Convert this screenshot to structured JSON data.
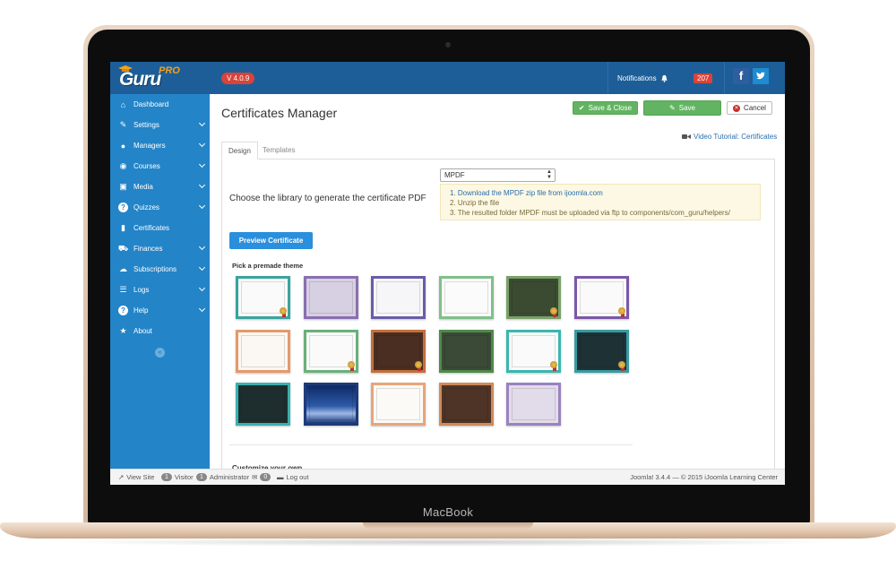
{
  "device": {
    "brand": "MacBook"
  },
  "header": {
    "logo_text": "Guru",
    "logo_badge": "PRO",
    "version": "V 4.0.9",
    "notifications_label": "Notifications",
    "notifications_count": "207",
    "facebook_label": "f"
  },
  "sidebar": {
    "items": [
      {
        "label": "Dashboard",
        "icon": "home-icon",
        "has_submenu": false
      },
      {
        "label": "Settings",
        "icon": "wrench-icon",
        "has_submenu": true
      },
      {
        "label": "Managers",
        "icon": "user-icon",
        "has_submenu": true
      },
      {
        "label": "Courses",
        "icon": "eye-icon",
        "has_submenu": true
      },
      {
        "label": "Media",
        "icon": "image-icon",
        "has_submenu": true
      },
      {
        "label": "Quizzes",
        "icon": "question-icon",
        "has_submenu": true
      },
      {
        "label": "Certificates",
        "icon": "bookmark-icon",
        "has_submenu": false
      },
      {
        "label": "Finances",
        "icon": "cart-icon",
        "has_submenu": true
      },
      {
        "label": "Subscriptions",
        "icon": "cloud-icon",
        "has_submenu": true
      },
      {
        "label": "Logs",
        "icon": "list-icon",
        "has_submenu": true
      },
      {
        "label": "Help",
        "icon": "question-icon",
        "has_submenu": true
      },
      {
        "label": "About",
        "icon": "star-icon",
        "has_submenu": false
      }
    ],
    "collapse_glyph": "«"
  },
  "main": {
    "title": "Certificates Manager",
    "toolbar": {
      "save_close_label": "Save & Close",
      "save_label": "Save",
      "cancel_label": "Cancel"
    },
    "video_link": "Video Tutorial: Certificates",
    "tabs": [
      {
        "label": "Design",
        "active": true
      },
      {
        "label": "Templates",
        "active": false
      }
    ],
    "library_label": "Choose the library to generate the certificate PDF",
    "library_select_value": "MPDF",
    "instructions": {
      "step1": "1. Download the MPDF zip file from ijoomla.com",
      "step2": "2. Unzip the file",
      "step3": "3. The resulted folder MPDF must be uploaded via ftp to components/com_guru/helpers/"
    },
    "preview_button": "Preview Certificate",
    "themes_label": "Pick a premade theme",
    "themes": [
      {
        "border": "#3aa39e",
        "bg": "#fafafa",
        "title_color": "#888",
        "seal": true
      },
      {
        "border": "#8a6fb0",
        "bg": "#d6d0e2",
        "title_color": "#666",
        "seal": false
      },
      {
        "border": "#6a5ca8",
        "bg": "#f6f6f8",
        "title_color": "#777",
        "seal": false
      },
      {
        "border": "#7fc08a",
        "bg": "#fbfbfb",
        "title_color": "#777",
        "seal": false
      },
      {
        "border": "#7aa06a",
        "bg": "#3b4b32",
        "title_color": "#b8b8a0",
        "seal": true
      },
      {
        "border": "#7a58a8",
        "bg": "#fafafa",
        "title_color": "#777",
        "seal": true
      },
      {
        "border": "#e39a6c",
        "bg": "#fbf7f3",
        "title_color": "#b07a50",
        "seal": false
      },
      {
        "border": "#6ab07a",
        "bg": "#fafafa",
        "title_color": "#777",
        "seal": true
      },
      {
        "border": "#c2703c",
        "bg": "#4a2e22",
        "title_color": "#c9a080",
        "seal": true
      },
      {
        "border": "#4f8a4a",
        "bg": "#3a4a36",
        "title_color": "#a8b098",
        "seal": false
      },
      {
        "border": "#3ab6b0",
        "bg": "#fafafa",
        "title_color": "#777",
        "seal": true
      },
      {
        "border": "#3a9aa0",
        "bg": "#1e3236",
        "title_color": "#9ab0b0",
        "seal": true
      },
      {
        "border": "#3ab0b0",
        "bg": "#1e2e2e",
        "title_color": "#7a9a9a",
        "seal": false
      },
      {
        "border": "#2a4a8a",
        "bg": "#1d3a78",
        "title_color": "#a0b8e0",
        "seal": false
      },
      {
        "border": "#e7a57a",
        "bg": "#fcfaf6",
        "title_color": "#c08060",
        "seal": false
      },
      {
        "border": "#d08a5a",
        "bg": "#4e3426",
        "title_color": "#d0a070",
        "seal": false
      },
      {
        "border": "#9a82c0",
        "bg": "#e2dcea",
        "title_color": "#777",
        "seal": false
      }
    ],
    "customize_label": "Customize your own"
  },
  "footer": {
    "view_site": "View Site",
    "visitor_count": "1",
    "visitor_label": "Visitor",
    "admin_count": "1",
    "admin_label": "Administrator",
    "messages_count": "0",
    "logout_label": "Log out",
    "copyright": "Joomla! 3.4.4  —  © 2015 iJoomla Learning Center"
  },
  "colors": {
    "header_bg": "#1e5e98",
    "sidebar_bg": "#2384c8",
    "success": "#62b462",
    "primary": "#2a8fdc",
    "danger": "#d9433a"
  }
}
